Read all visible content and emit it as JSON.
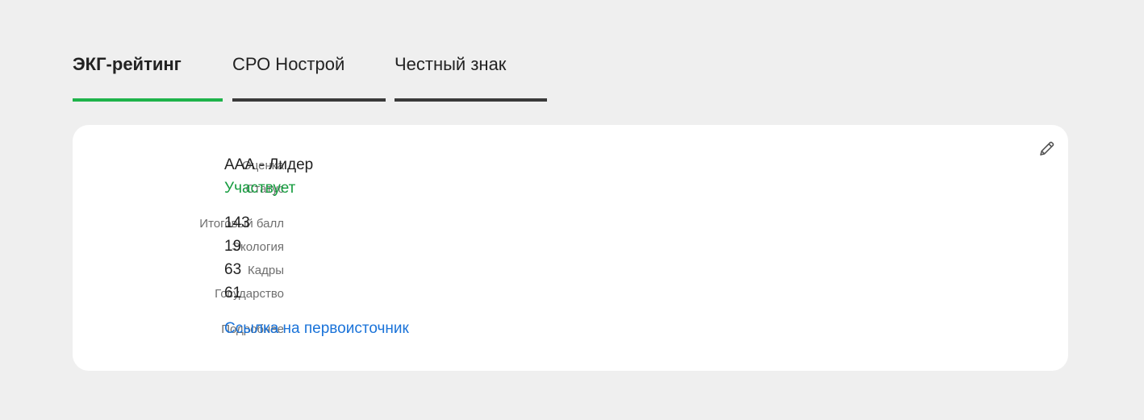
{
  "tabs": [
    {
      "label": "ЭКГ-рейтинг",
      "active": true
    },
    {
      "label": "СРО Нострой",
      "active": false
    },
    {
      "label": "Честный знак",
      "active": false
    }
  ],
  "card": {
    "edit_icon": "pencil-icon",
    "rows": [
      {
        "label": "Оценка",
        "value": "ААА - Лидер"
      },
      {
        "label": "Статус",
        "value": "Участвует"
      },
      {
        "label": "Итоговый балл",
        "value": "143"
      },
      {
        "label": "Экология",
        "value": "19"
      },
      {
        "label": "Кадры",
        "value": "63"
      },
      {
        "label": "Государство",
        "value": "61"
      },
      {
        "label": "Подробнее",
        "value": "Ссылка на первоисточник"
      }
    ]
  },
  "colors": {
    "accent": "#1eb34a",
    "status_green": "#169c3f",
    "link_blue": "#1a73d9",
    "background": "#efefef"
  }
}
